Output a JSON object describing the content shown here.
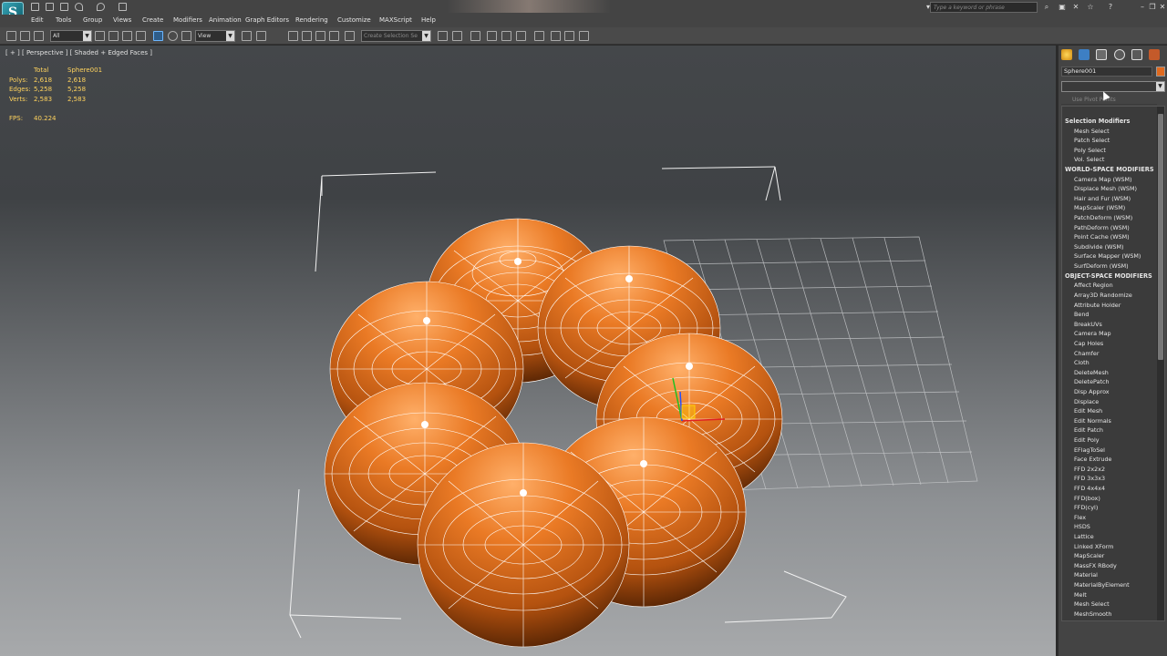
{
  "app": {
    "logo_glyph": "S"
  },
  "menu": [
    "Edit",
    "Tools",
    "Group",
    "Views",
    "Create",
    "Modifiers",
    "Animation",
    "Graph Editors",
    "Rendering",
    "Customize",
    "MAXScript",
    "Help"
  ],
  "search": {
    "placeholder": "Type a keyword or phrase"
  },
  "toolbar": {
    "selection_filter": "All",
    "reference_coord": "View",
    "named_selection": "Create Selection Se"
  },
  "viewport": {
    "label": "[ + ] [ Perspective ] [ Shaded + Edged Faces ]",
    "stats": {
      "header": [
        "",
        "Total",
        "Sphere001"
      ],
      "rows": [
        {
          "label": "Polys:",
          "total": "2,618",
          "object": "2,618"
        },
        {
          "label": "Edges:",
          "total": "5,258",
          "object": "5,258"
        },
        {
          "label": "Verts:",
          "total": "2,583",
          "object": "2,583"
        }
      ],
      "fps_label": "FPS:",
      "fps_value": "40.224"
    },
    "accent_color": "#e2711d"
  },
  "command_panel": {
    "object_name": "Sphere001",
    "object_color": "#e06a1f",
    "use_pivot_label": "Use Pivot Points",
    "modifier_groups": [
      {
        "category": "Selection Modifiers",
        "items": [
          "Mesh Select",
          "Patch Select",
          "Poly Select",
          "Vol. Select"
        ]
      },
      {
        "category": "WORLD-SPACE MODIFIERS",
        "items": [
          "Camera Map (WSM)",
          "Displace Mesh (WSM)",
          "Hair and Fur (WSM)",
          "MapScaler (WSM)",
          "PatchDeform (WSM)",
          "PathDeform (WSM)",
          "Point Cache (WSM)",
          "Subdivide (WSM)",
          "Surface Mapper (WSM)",
          "SurfDeform (WSM)"
        ]
      },
      {
        "category": "OBJECT-SPACE MODIFIERS",
        "items": [
          "Affect Region",
          "Array3D Randomize",
          "Attribute Holder",
          "Bend",
          "BreakUVs",
          "Camera Map",
          "Cap Holes",
          "Chamfer",
          "Cloth",
          "DeleteMesh",
          "DeletePatch",
          "Disp Approx",
          "Displace",
          "Edit Mesh",
          "Edit Normals",
          "Edit Patch",
          "Edit Poly",
          "EFlagToSel",
          "Face Extrude",
          "FFD 2x2x2",
          "FFD 3x3x3",
          "FFD 4x4x4",
          "FFD(box)",
          "FFD(cyl)",
          "Flex",
          "HSDS",
          "Lattice",
          "Linked XForm",
          "MapScaler",
          "MassFX RBody",
          "Material",
          "MaterialByElement",
          "Melt",
          "Mesh Select",
          "MeshSmooth"
        ]
      }
    ]
  }
}
